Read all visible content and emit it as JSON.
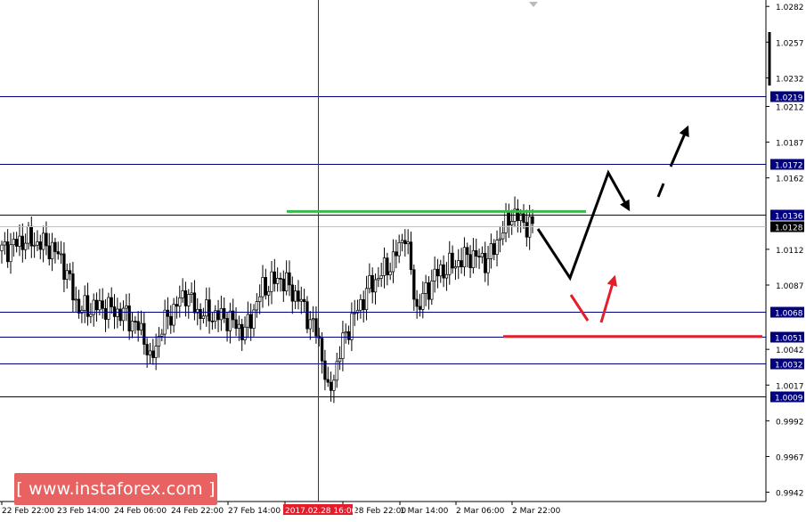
{
  "chart_data": {
    "type": "candlestick",
    "symbol_watermark": "[ www.instaforex.com ]",
    "ylim": [
      0.99355,
      1.02865
    ],
    "y_ticks": [
      "1.0282",
      "1.0257",
      "1.0232",
      "1.0212",
      "1.0187",
      "1.0162",
      "1.0112",
      "1.0087",
      "1.0042",
      "1.0017",
      "0.9992",
      "0.9967",
      "0.9942"
    ],
    "x_ticks": [
      "22 Feb 22:00",
      "23 Feb 14:00",
      "24 Feb 06:00",
      "24 Feb 22:00",
      "27 Feb 14:00",
      "2017.02.28 16:00",
      "28 Feb 22:00",
      "1 Mar 14:00",
      "2 Mar 06:00",
      "2 Mar 22:00"
    ],
    "current_price": "1.0128",
    "crosshair_time": "2017.02.28 16:00",
    "levels": [
      {
        "value": 1.0219,
        "label": "1.0219"
      },
      {
        "value": 1.0172,
        "label": "1.0172"
      },
      {
        "value": 1.0136,
        "label": "1.0136"
      },
      {
        "value": 1.0068,
        "label": "1.0068"
      },
      {
        "value": 1.0051,
        "label": "1.0051"
      },
      {
        "value": 1.0032,
        "label": "1.0032"
      },
      {
        "value": 1.0009,
        "label": "1.0009"
      }
    ],
    "colors": {
      "level_line": "#00007f",
      "grid": "#ccd3e6",
      "candle": "#000000",
      "crosshair": "#c00000",
      "resistance": "#3cb94c",
      "support": "#e41d2b",
      "bull_scenario": "#000000",
      "bear_scenario": "#e41d2b",
      "time_badge": "#e41d2b"
    },
    "annotations": {
      "green_line": {
        "value": 1.01385,
        "from": "28 Feb 16:00",
        "to": "2 Mar 14:00"
      },
      "red_line": {
        "value": 1.0051,
        "from": "2 Mar 06:00",
        "to": "right edge"
      }
    },
    "grid": false,
    "legend": "none"
  }
}
